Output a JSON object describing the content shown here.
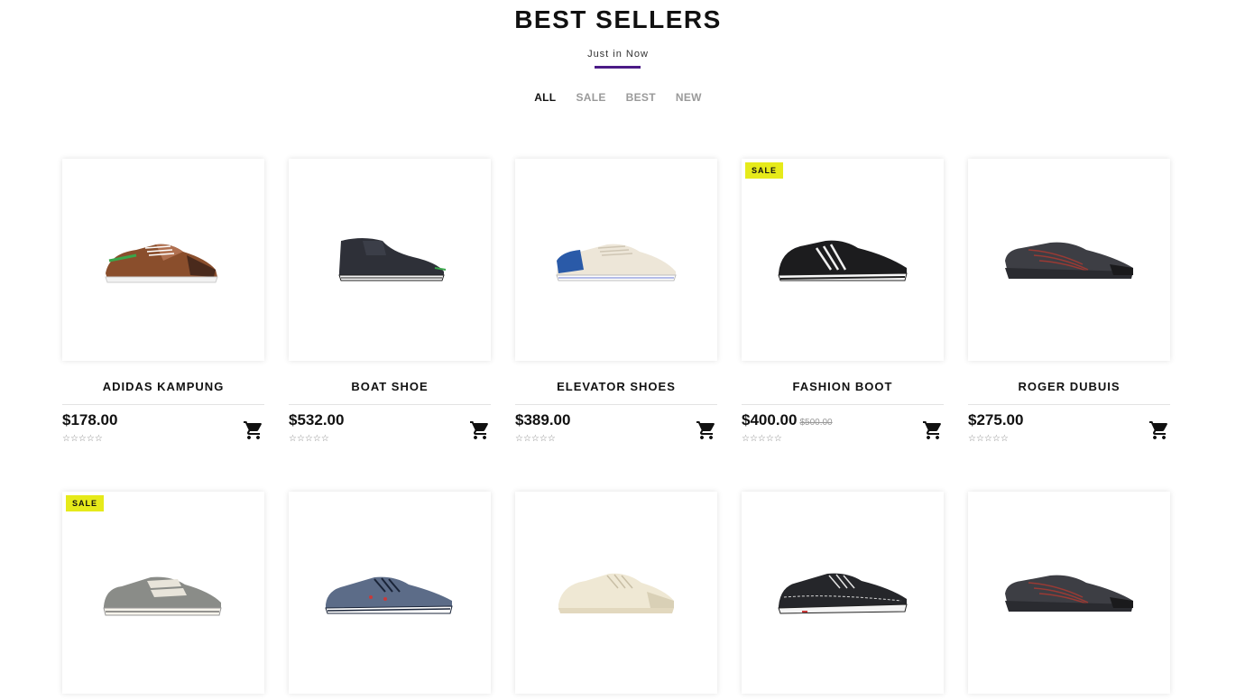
{
  "section": {
    "title": "BEST SELLERS",
    "subtitle": "Just in Now",
    "accent_color": "#4b1a86"
  },
  "tabs": [
    {
      "label": "ALL",
      "active": true
    },
    {
      "label": "SALE",
      "active": false
    },
    {
      "label": "BEST",
      "active": false
    },
    {
      "label": "NEW",
      "active": false
    }
  ],
  "badge_color": "#e6ea1a",
  "products": [
    {
      "name": "ADIDAS KAMPUNG",
      "price": "$178.00",
      "old_price": "",
      "badge": "",
      "stars": "☆☆☆☆☆",
      "shoe": "brown-sneaker"
    },
    {
      "name": "BOAT SHOE",
      "price": "$532.00",
      "old_price": "",
      "badge": "",
      "stars": "☆☆☆☆☆",
      "shoe": "dark-chukka"
    },
    {
      "name": "ELEVATOR SHOES",
      "price": "$389.00",
      "old_price": "",
      "badge": "",
      "stars": "☆☆☆☆☆",
      "shoe": "white-perforated-sneaker"
    },
    {
      "name": "FASHION BOOT",
      "price": "$400.00",
      "old_price": "$500.00",
      "badge": "SALE",
      "stars": "☆☆☆☆☆",
      "shoe": "black-leather-sneaker"
    },
    {
      "name": "ROGER DUBUIS",
      "price": "$275.00",
      "old_price": "",
      "badge": "",
      "stars": "☆☆☆☆☆",
      "shoe": "grey-red-sneaker"
    },
    {
      "name": "",
      "price": "",
      "old_price": "",
      "badge": "SALE",
      "stars": "",
      "shoe": "grey-velcro-sneaker"
    },
    {
      "name": "",
      "price": "",
      "old_price": "",
      "badge": "",
      "stars": "",
      "shoe": "blue-canvas-sneaker"
    },
    {
      "name": "",
      "price": "",
      "old_price": "",
      "badge": "",
      "stars": "",
      "shoe": "cream-driving-shoe"
    },
    {
      "name": "",
      "price": "",
      "old_price": "",
      "badge": "",
      "stars": "",
      "shoe": "black-suede-shoe"
    },
    {
      "name": "",
      "price": "",
      "old_price": "",
      "badge": "",
      "stars": "",
      "shoe": "grey-red-sneaker"
    }
  ]
}
